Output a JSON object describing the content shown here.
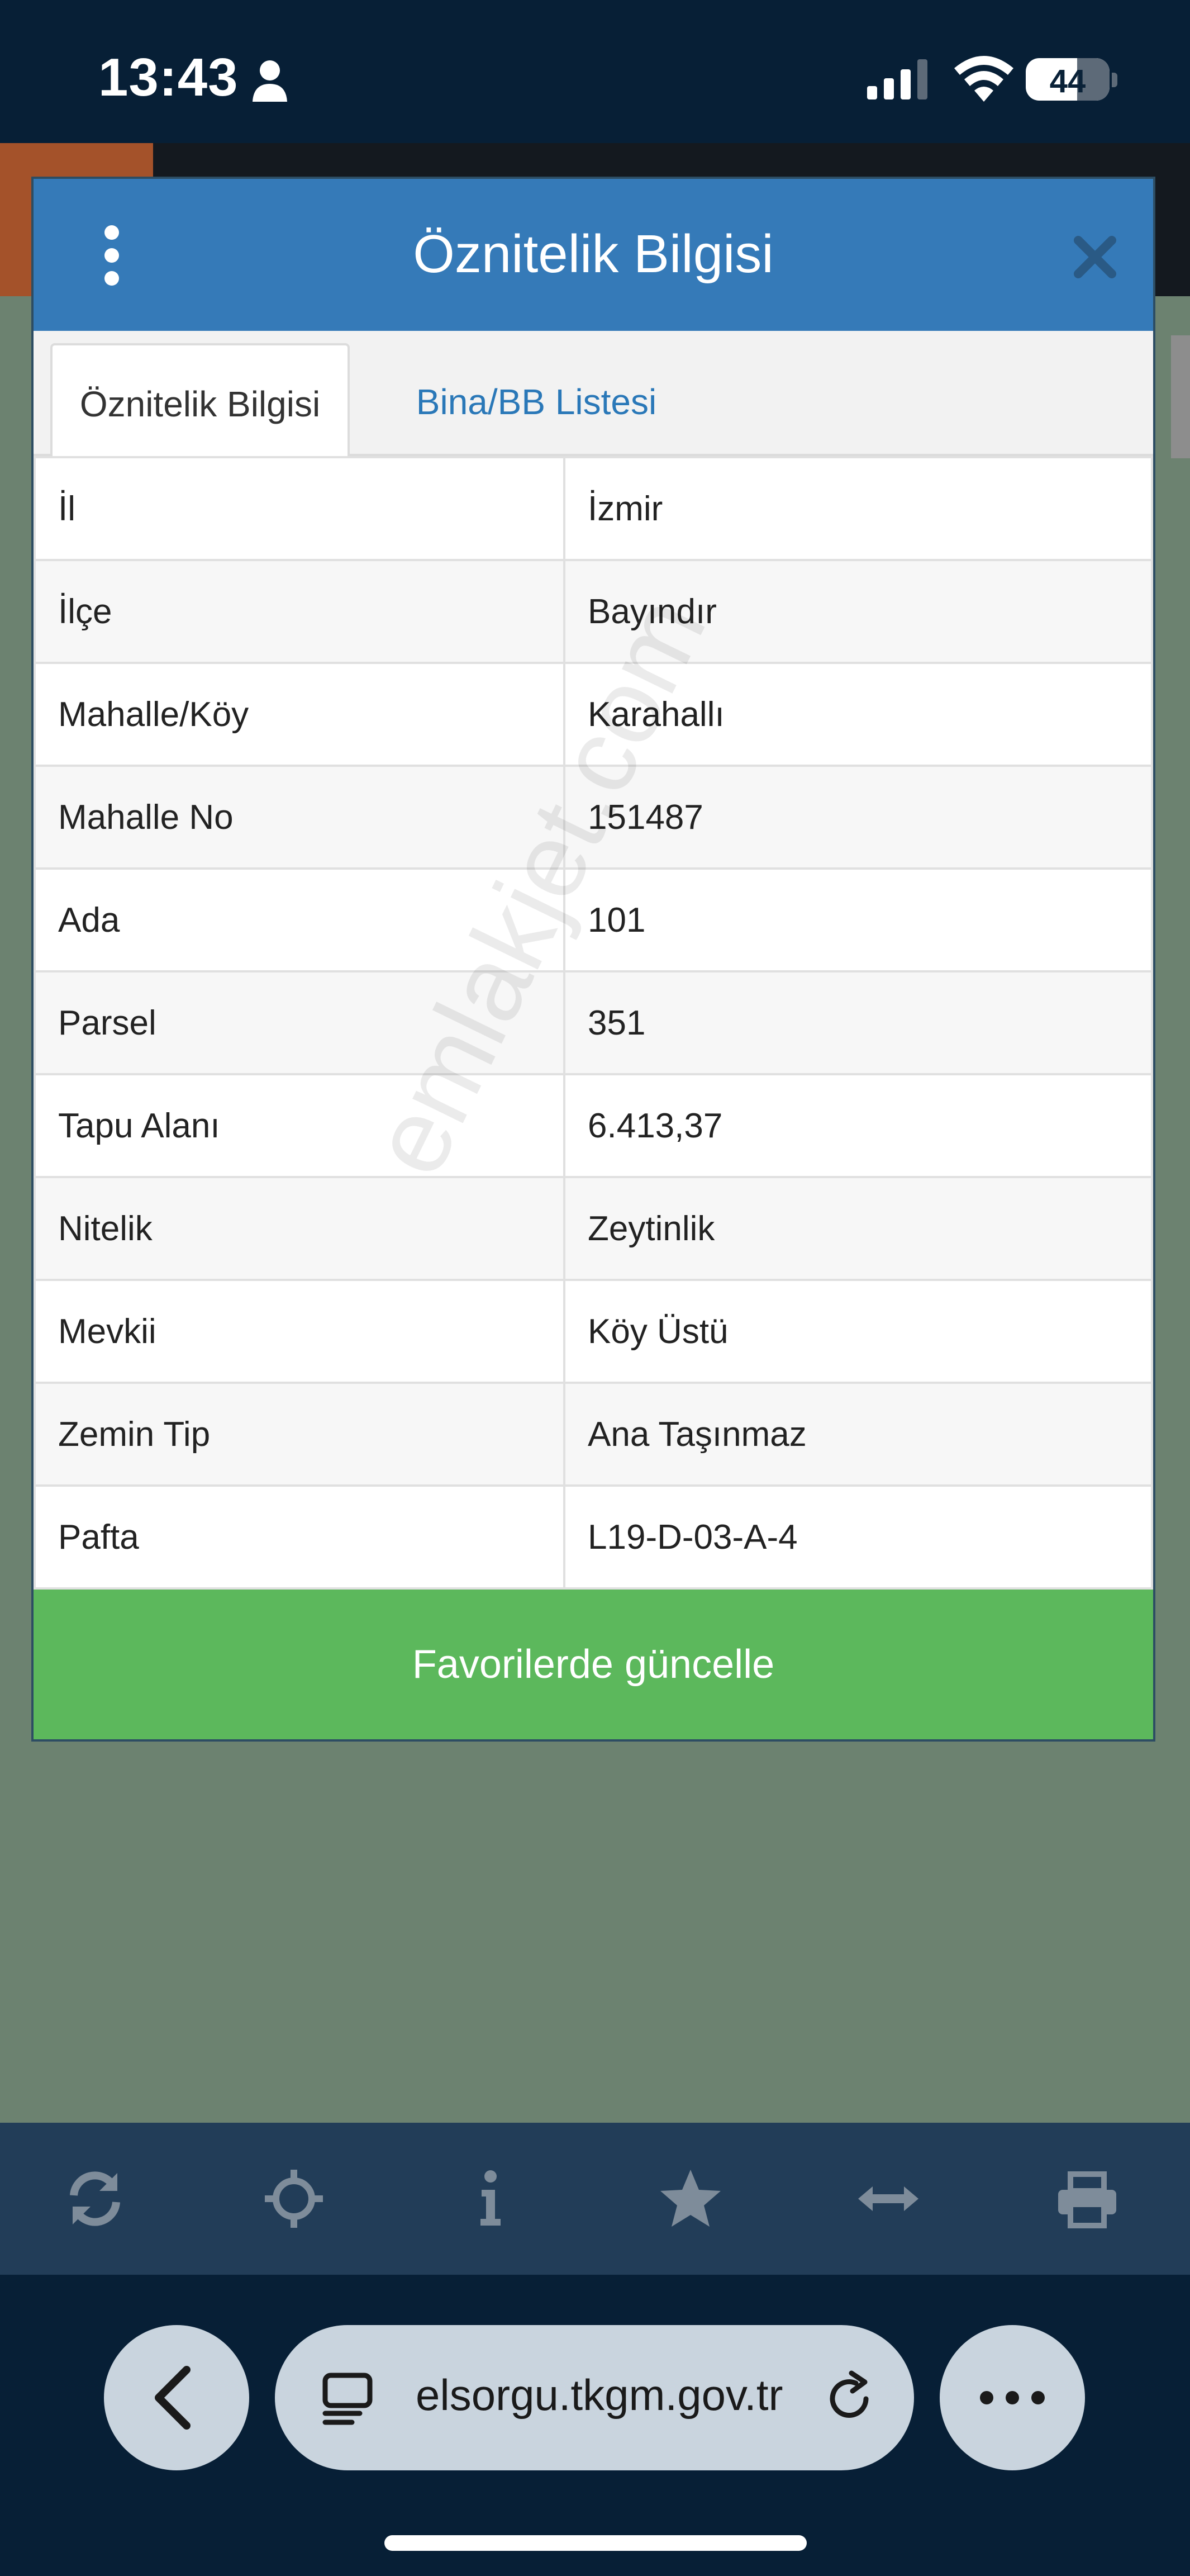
{
  "status_bar": {
    "time": "13:43",
    "battery": "44"
  },
  "dialog": {
    "title": "Öznitelik Bilgisi",
    "tabs": [
      {
        "label": "Öznitelik Bilgisi",
        "active": true
      },
      {
        "label": "Bina/BB Listesi",
        "active": false
      }
    ],
    "rows": [
      {
        "key": "İl",
        "value": "İzmir"
      },
      {
        "key": "İlçe",
        "value": "Bayındır"
      },
      {
        "key": "Mahalle/Köy",
        "value": "Karahallı"
      },
      {
        "key": "Mahalle No",
        "value": "151487"
      },
      {
        "key": "Ada",
        "value": "101"
      },
      {
        "key": "Parsel",
        "value": "351"
      },
      {
        "key": "Tapu Alanı",
        "value": "6.413,37"
      },
      {
        "key": "Nitelik",
        "value": "Zeytinlik"
      },
      {
        "key": "Mevkii",
        "value": "Köy Üstü"
      },
      {
        "key": "Zemin Tip",
        "value": "Ana Taşınmaz"
      },
      {
        "key": "Pafta",
        "value": "L19-D-03-A-4"
      }
    ],
    "update_button_label": "Favorilerde güncelle"
  },
  "watermark": "emlakjet.com",
  "toolbar": {
    "icons": [
      "refresh-icon",
      "crosshair-icon",
      "info-icon",
      "star-icon",
      "measure-icon",
      "print-icon"
    ]
  },
  "browser": {
    "url": "elsorgu.tkgm.gov.tr"
  },
  "colors": {
    "header": "#357ab8",
    "button": "#5cb85c",
    "toolbar": "#223d58",
    "link": "#2a78b8"
  }
}
